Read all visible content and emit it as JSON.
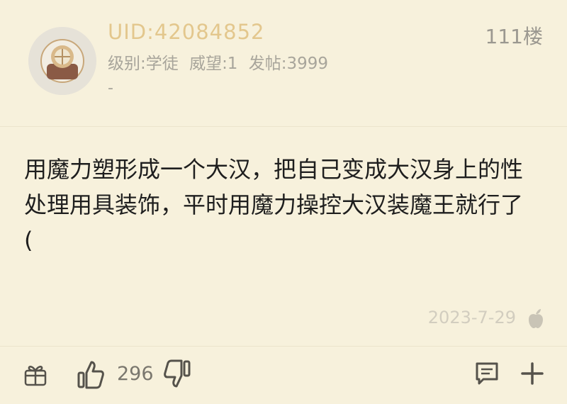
{
  "post": {
    "uid": "UID:42084852",
    "floor": "111楼",
    "level": "级别:学徒",
    "prestige": "威望:1",
    "posts": "发帖:3999",
    "dash": "-",
    "content": "用魔力塑形成一个大汉，把自己变成大汉身上的性\n处理用具装饰，平时用魔力操控大汉装魔王就行了\n(",
    "date": "2023-7-29",
    "likes": "296"
  },
  "icons": {
    "avatar": "avatar",
    "device": "apple-icon",
    "gift": "gift-icon",
    "like": "thumbs-up-icon",
    "dislike": "thumbs-down-icon",
    "comment": "comment-icon",
    "add": "plus-icon"
  },
  "colors": {
    "background": "#f7f1dc",
    "uid": "#e3c78d",
    "meta": "#a8a59b",
    "text": "#1e1e1e"
  }
}
